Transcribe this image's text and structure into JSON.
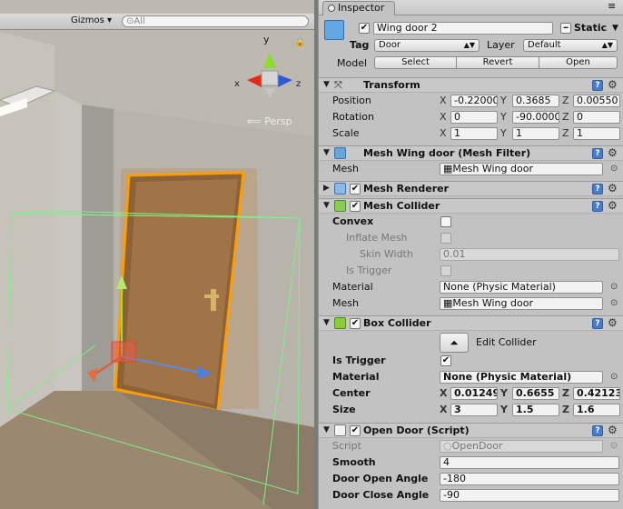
{
  "scene": {
    "gizmos_label": "Gizmos",
    "search_placeholder": "All",
    "persp_label": "Persp",
    "axis_y": "y",
    "axis_x": "x",
    "axis_z": "z"
  },
  "inspector": {
    "tab_label": "Inspector",
    "object": {
      "name": "Wing door 2",
      "static_label": "Static",
      "tag_label": "Tag",
      "tag_value": "Door",
      "layer_label": "Layer",
      "layer_value": "Default",
      "model_label": "Model",
      "btn_select": "Select",
      "btn_revert": "Revert",
      "btn_open": "Open"
    },
    "transform": {
      "title": "Transform",
      "position_label": "Position",
      "rotation_label": "Rotation",
      "scale_label": "Scale",
      "x": "X",
      "y": "Y",
      "z": "Z",
      "position": [
        "-0.22000",
        "0.3685",
        "0.00550"
      ],
      "rotation": [
        "0",
        "-90.0000",
        "0"
      ],
      "scale": [
        "1",
        "1",
        "1"
      ]
    },
    "mesh_filter": {
      "title": "Mesh Wing door (Mesh Filter)",
      "mesh_label": "Mesh",
      "mesh_value": "Mesh Wing door"
    },
    "mesh_renderer": {
      "title": "Mesh Renderer"
    },
    "mesh_collider": {
      "title": "Mesh Collider",
      "convex_label": "Convex",
      "inflate_label": "Inflate Mesh",
      "skin_label": "Skin Width",
      "skin_value": "0.01",
      "trigger_label": "Is Trigger",
      "material_label": "Material",
      "material_value": "None (Physic Material)",
      "mesh_label": "Mesh",
      "mesh_value": "Mesh Wing door"
    },
    "box_collider": {
      "title": "Box Collider",
      "edit_label": "Edit Collider",
      "trigger_label": "Is Trigger",
      "material_label": "Material",
      "material_value": "None (Physic Material)",
      "center_label": "Center",
      "center": [
        "0.01249",
        "0.6655",
        "0.42123"
      ],
      "size_label": "Size",
      "size": [
        "3",
        "1.5",
        "1.6"
      ]
    },
    "open_door": {
      "title": "Open Door (Script)",
      "script_label": "Script",
      "script_value": "OpenDoor",
      "smooth_label": "Smooth",
      "smooth_value": "4",
      "open_angle_label": "Door Open Angle",
      "open_angle_value": "-180",
      "close_angle_label": "Door Close Angle",
      "close_angle_value": "-90"
    }
  }
}
